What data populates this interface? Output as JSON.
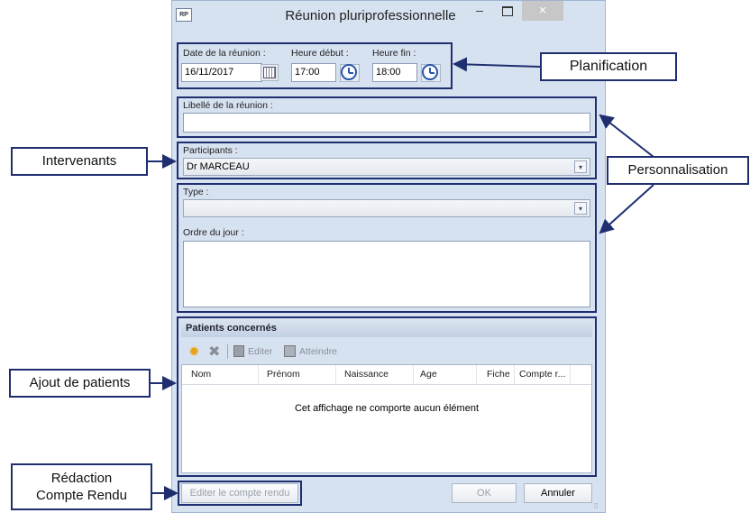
{
  "window": {
    "app_icon": "RP",
    "title": "Réunion pluriprofessionnelle",
    "minimize": "–",
    "close": "×"
  },
  "planning": {
    "date_label": "Date de la réunion :",
    "date_value": "16/11/2017",
    "start_label": "Heure début :",
    "start_value": "17:00",
    "end_label": "Heure fin :",
    "end_value": "18:00"
  },
  "libelle": {
    "label": "Libellé de la réunion :",
    "value": ""
  },
  "participants": {
    "label": "Participants :",
    "value": "Dr MARCEAU"
  },
  "type": {
    "label": "Type :",
    "value": ""
  },
  "ordre": {
    "label": "Ordre du jour :",
    "value": ""
  },
  "patients": {
    "header": "Patients concernés",
    "toolbar": {
      "edit": "Editer",
      "goto": "Atteindre"
    },
    "columns": [
      "Nom",
      "Prénom",
      "Naissance",
      "Age",
      "Fiche",
      "Compte r..."
    ],
    "empty": "Cet affichage ne comporte aucun élément"
  },
  "buttons": {
    "report": "Editer le compte rendu",
    "ok": "OK",
    "cancel": "Annuler"
  },
  "annotations": {
    "planification": "Planification",
    "intervenants": "Intervenants",
    "personnalisation": "Personnalisation",
    "ajout": "Ajout de patients",
    "redaction_1": "Rédaction",
    "redaction_2": "Compte Rendu"
  },
  "colors": {
    "window_bg": "#d7e2f1",
    "annotation_border": "#1e2e6f",
    "clock": "#2a56a8"
  }
}
